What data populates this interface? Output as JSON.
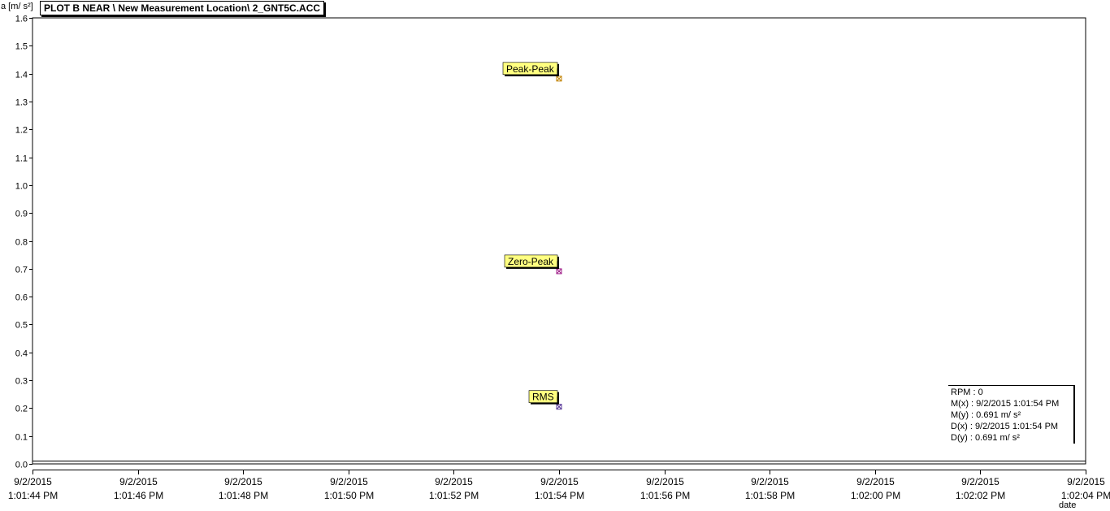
{
  "header": {
    "title": "PLOT B NEAR \\ New Measurement Location\\ 2_GNT5C.ACC",
    "y_unit_label": "a [m/ s²]",
    "x_unit_label": "date"
  },
  "chart_data": {
    "type": "scatter",
    "title": "PLOT B NEAR \\ New Measurement Location\\ 2_GNT5C.ACC",
    "xlabel": "date",
    "ylabel": "a [m/ s²]",
    "x_ticks": [
      {
        "value": "9/2/2015 1:01:44 PM",
        "line1": "9/2/2015",
        "line2": "1:01:44 PM"
      },
      {
        "value": "9/2/2015 1:01:46 PM",
        "line1": "9/2/2015",
        "line2": "1:01:46 PM"
      },
      {
        "value": "9/2/2015 1:01:48 PM",
        "line1": "9/2/2015",
        "line2": "1:01:48 PM"
      },
      {
        "value": "9/2/2015 1:01:50 PM",
        "line1": "9/2/2015",
        "line2": "1:01:50 PM"
      },
      {
        "value": "9/2/2015 1:01:52 PM",
        "line1": "9/2/2015",
        "line2": "1:01:52 PM"
      },
      {
        "value": "9/2/2015 1:01:54 PM",
        "line1": "9/2/2015",
        "line2": "1:01:54 PM"
      },
      {
        "value": "9/2/2015 1:01:56 PM",
        "line1": "9/2/2015",
        "line2": "1:01:56 PM"
      },
      {
        "value": "9/2/2015 1:01:58 PM",
        "line1": "9/2/2015",
        "line2": "1:01:58 PM"
      },
      {
        "value": "9/2/2015 1:02:00 PM",
        "line1": "9/2/2015",
        "line2": "1:02:00 PM"
      },
      {
        "value": "9/2/2015 1:02:02 PM",
        "line1": "9/2/2015",
        "line2": "1:02:02 PM"
      },
      {
        "value": "9/2/2015 1:02:04 PM",
        "line1": "9/2/2015",
        "line2": "1:02:04 PM"
      }
    ],
    "xlim": [
      "9/2/2015 1:01:44 PM",
      "9/2/2015 1:02:04 PM"
    ],
    "y_ticks": [
      "0.0",
      "0.1",
      "0.2",
      "0.3",
      "0.4",
      "0.5",
      "0.6",
      "0.7",
      "0.8",
      "0.9",
      "1.0",
      "1.1",
      "1.2",
      "1.3",
      "1.4",
      "1.5",
      "1.6"
    ],
    "ylim": [
      0,
      1.6
    ],
    "grid": true,
    "series": [
      {
        "name": "Peak-Peak",
        "x": "9/2/2015 1:01:54 PM",
        "y": 1.382,
        "color": "#c08000"
      },
      {
        "name": "Zero-Peak",
        "x": "9/2/2015 1:01:54 PM",
        "y": 0.691,
        "color": "#a0208a"
      },
      {
        "name": "RMS",
        "x": "9/2/2015 1:01:54 PM",
        "y": 0.205,
        "color": "#5a3a9a"
      }
    ],
    "label_color": "#ffff80"
  },
  "info_box": {
    "rpm": "RPM : 0",
    "mx": "M(x) : 9/2/2015 1:01:54 PM",
    "my": "M(y) : 0.691 m/ s²",
    "dx": "D(x) : 9/2/2015 1:01:54 PM",
    "dy": "D(y) : 0.691 m/ s²"
  }
}
